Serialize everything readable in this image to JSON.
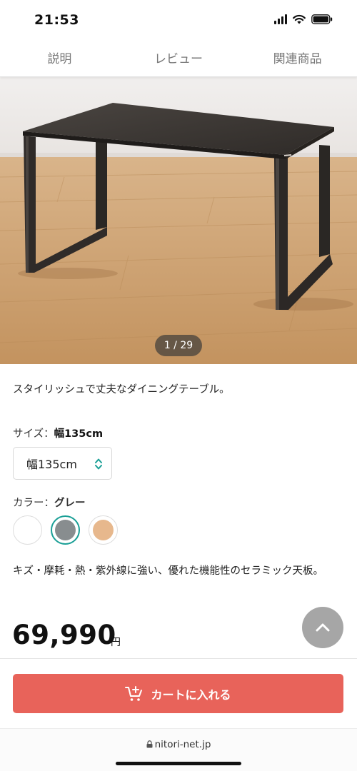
{
  "status_bar": {
    "time": "21:53"
  },
  "tabs": [
    {
      "label": "説明"
    },
    {
      "label": "レビュー"
    },
    {
      "label": "関連商品"
    }
  ],
  "gallery": {
    "counter": "1 / 29"
  },
  "product": {
    "tagline": "スタイリッシュで丈夫なダイニングテーブル。",
    "size": {
      "label": "サイズ：",
      "selected": "幅135cm",
      "select_value": "幅135cm"
    },
    "color": {
      "label": "カラー：",
      "selected": "グレー",
      "swatches": [
        {
          "name": "white",
          "color": "#ffffff"
        },
        {
          "name": "gray",
          "color": "#888d8f",
          "selected": true
        },
        {
          "name": "beige",
          "color": "#e7b88d"
        }
      ]
    },
    "feature_text": "キズ・摩耗・熱・紫外線に強い、優れた機能性のセラミック天板。",
    "price": "69,990",
    "currency": "円"
  },
  "cart": {
    "label": "カートに入れる",
    "color": "#e8635a"
  },
  "browser": {
    "url": "nitori-net.jp"
  },
  "colors": {
    "accent": "#1a9f96"
  }
}
